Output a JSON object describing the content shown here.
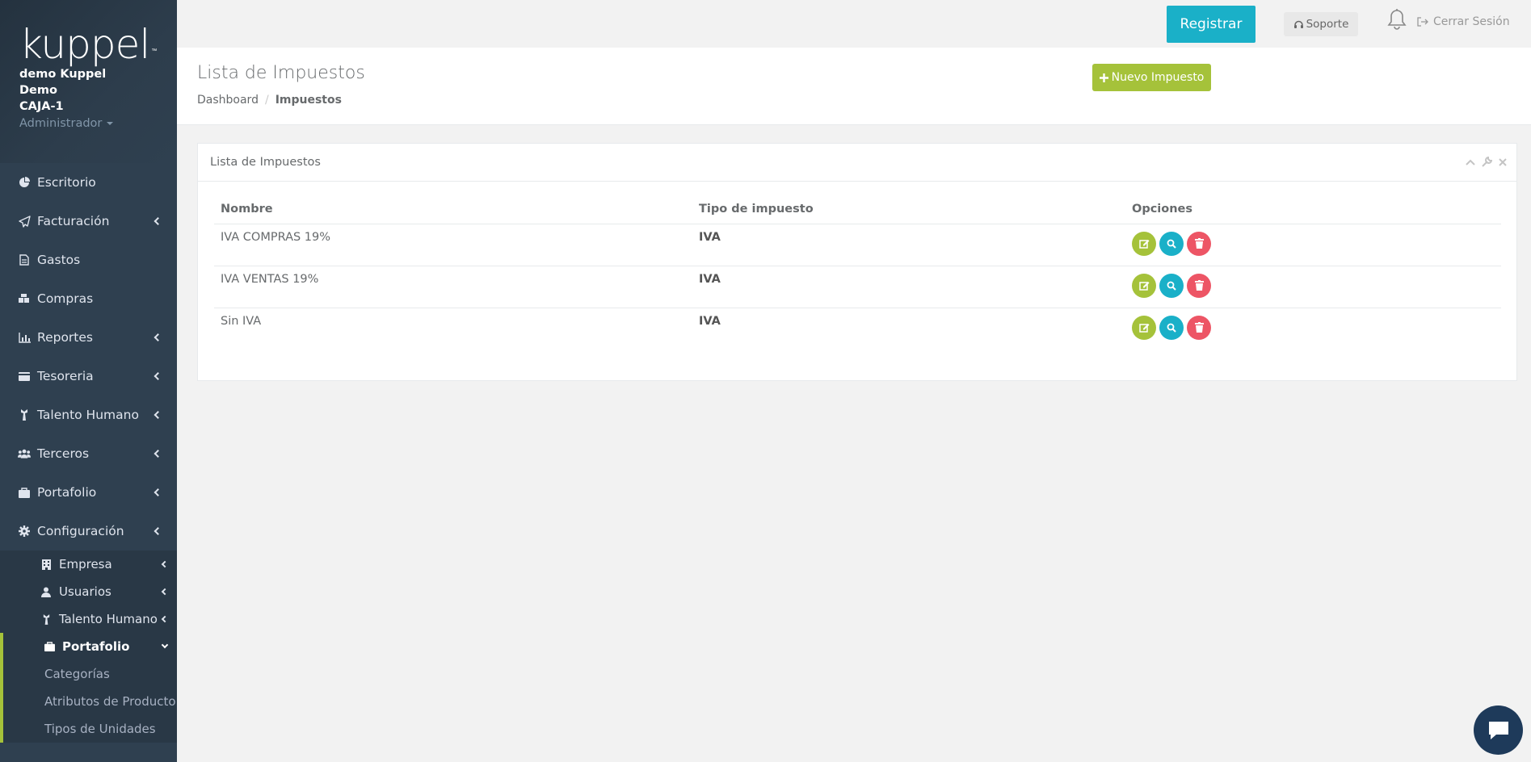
{
  "brand": {
    "logo": "kuppel",
    "tm": "™"
  },
  "user": {
    "line1": "demo Kuppel",
    "line2": "Demo",
    "line3": "CAJA-1",
    "role": "Administrador"
  },
  "sidebar": {
    "items": [
      {
        "label": "Escritorio",
        "icon": "dashboard-icon"
      },
      {
        "label": "Facturación",
        "icon": "paper-plane-icon"
      },
      {
        "label": "Gastos",
        "icon": "file-icon"
      },
      {
        "label": "Compras",
        "icon": "boxes-icon"
      },
      {
        "label": "Reportes",
        "icon": "bar-chart-icon"
      },
      {
        "label": "Tesoreria",
        "icon": "wallet-icon"
      },
      {
        "label": "Talento Humano",
        "icon": "person-tie-icon"
      },
      {
        "label": "Terceros",
        "icon": "users-icon"
      },
      {
        "label": "Portafolio",
        "icon": "briefcase-icon"
      },
      {
        "label": "Configuración",
        "icon": "gear-icon"
      }
    ],
    "sub_items": [
      {
        "label": "Empresa",
        "icon": "building-icon"
      },
      {
        "label": "Usuarios",
        "icon": "user-icon"
      },
      {
        "label": "Talento Humano",
        "icon": "person-tie-icon"
      },
      {
        "label": "Portafolio",
        "icon": "briefcase-icon"
      }
    ],
    "portafolio_children": [
      "Categorías",
      "Atributos de Producto",
      "Tipos de Unidades"
    ]
  },
  "topbar": {
    "register": "Registrar",
    "support": "Soporte",
    "logout": "Cerrar Sesión"
  },
  "heading": {
    "title": "Lista de Impuestos",
    "crumb1": "Dashboard",
    "crumb_sep": "/",
    "crumb2": "Impuestos",
    "new_button": "Nuevo Impuesto"
  },
  "panel": {
    "title": "Lista de Impuestos",
    "columns": [
      "Nombre",
      "Tipo de impuesto",
      "Opciones"
    ],
    "rows": [
      {
        "nombre": "IVA COMPRAS 19%",
        "tipo": "IVA"
      },
      {
        "nombre": "IVA VENTAS 19%",
        "tipo": "IVA"
      },
      {
        "nombre": "Sin IVA",
        "tipo": "IVA"
      }
    ]
  },
  "colors": {
    "sidebar": "#2f4050",
    "accent_green": "#a5c23a",
    "accent_teal": "#1ab0c8",
    "danger": "#ed5565"
  }
}
